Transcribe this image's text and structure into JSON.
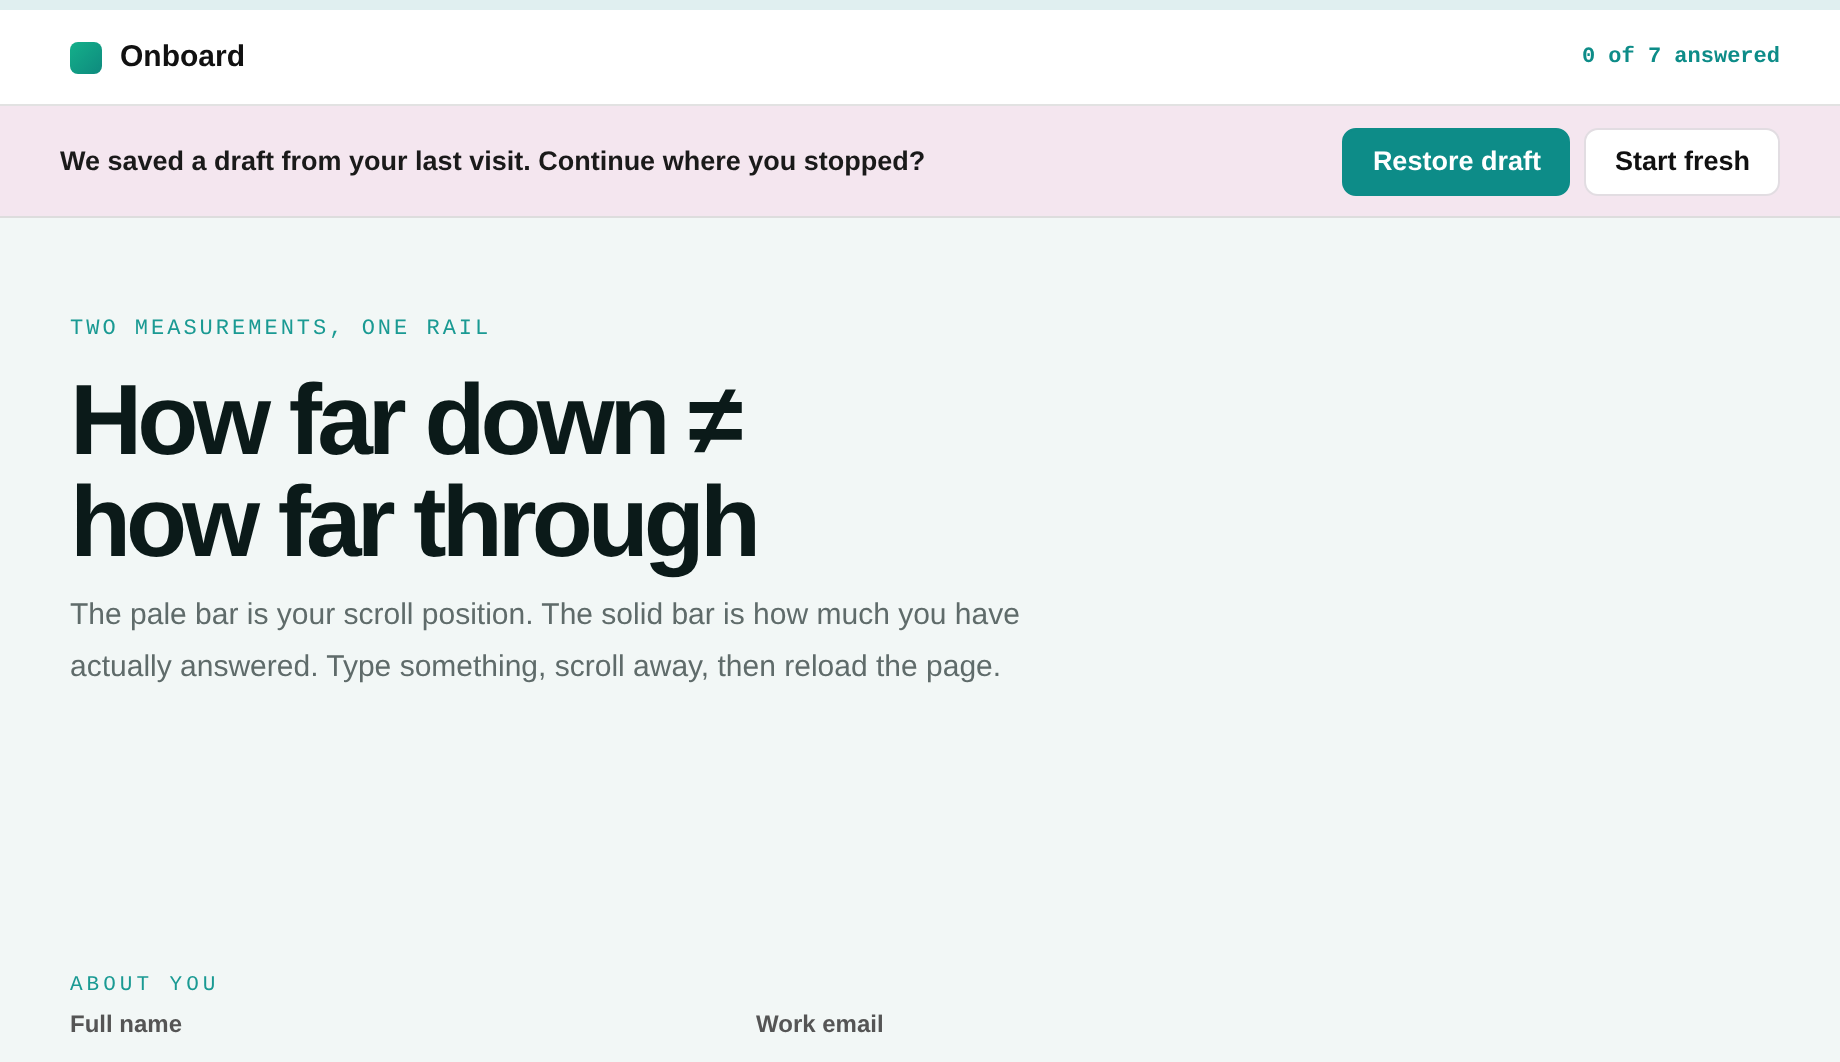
{
  "header": {
    "brand": "Onboard",
    "progress": "0 of 7 answered"
  },
  "banner": {
    "message": "We saved a draft from your last visit. Continue where you stopped?",
    "buttons": [
      {
        "label": "Restore draft",
        "kind": "primary"
      },
      {
        "label": "Start fresh",
        "kind": "secondary"
      }
    ]
  },
  "hero": {
    "eyebrow": "TWO MEASUREMENTS, ONE RAIL",
    "title_lines": [
      "How far down ≠",
      "how far through"
    ],
    "description": "The pale bar is your scroll position. The solid bar is how much you have actually answered. Type something, scroll away, then reload the page."
  },
  "section": {
    "heading": "ABOUT YOU",
    "fields": [
      {
        "label": "Full name"
      },
      {
        "label": "Work email"
      }
    ]
  }
}
